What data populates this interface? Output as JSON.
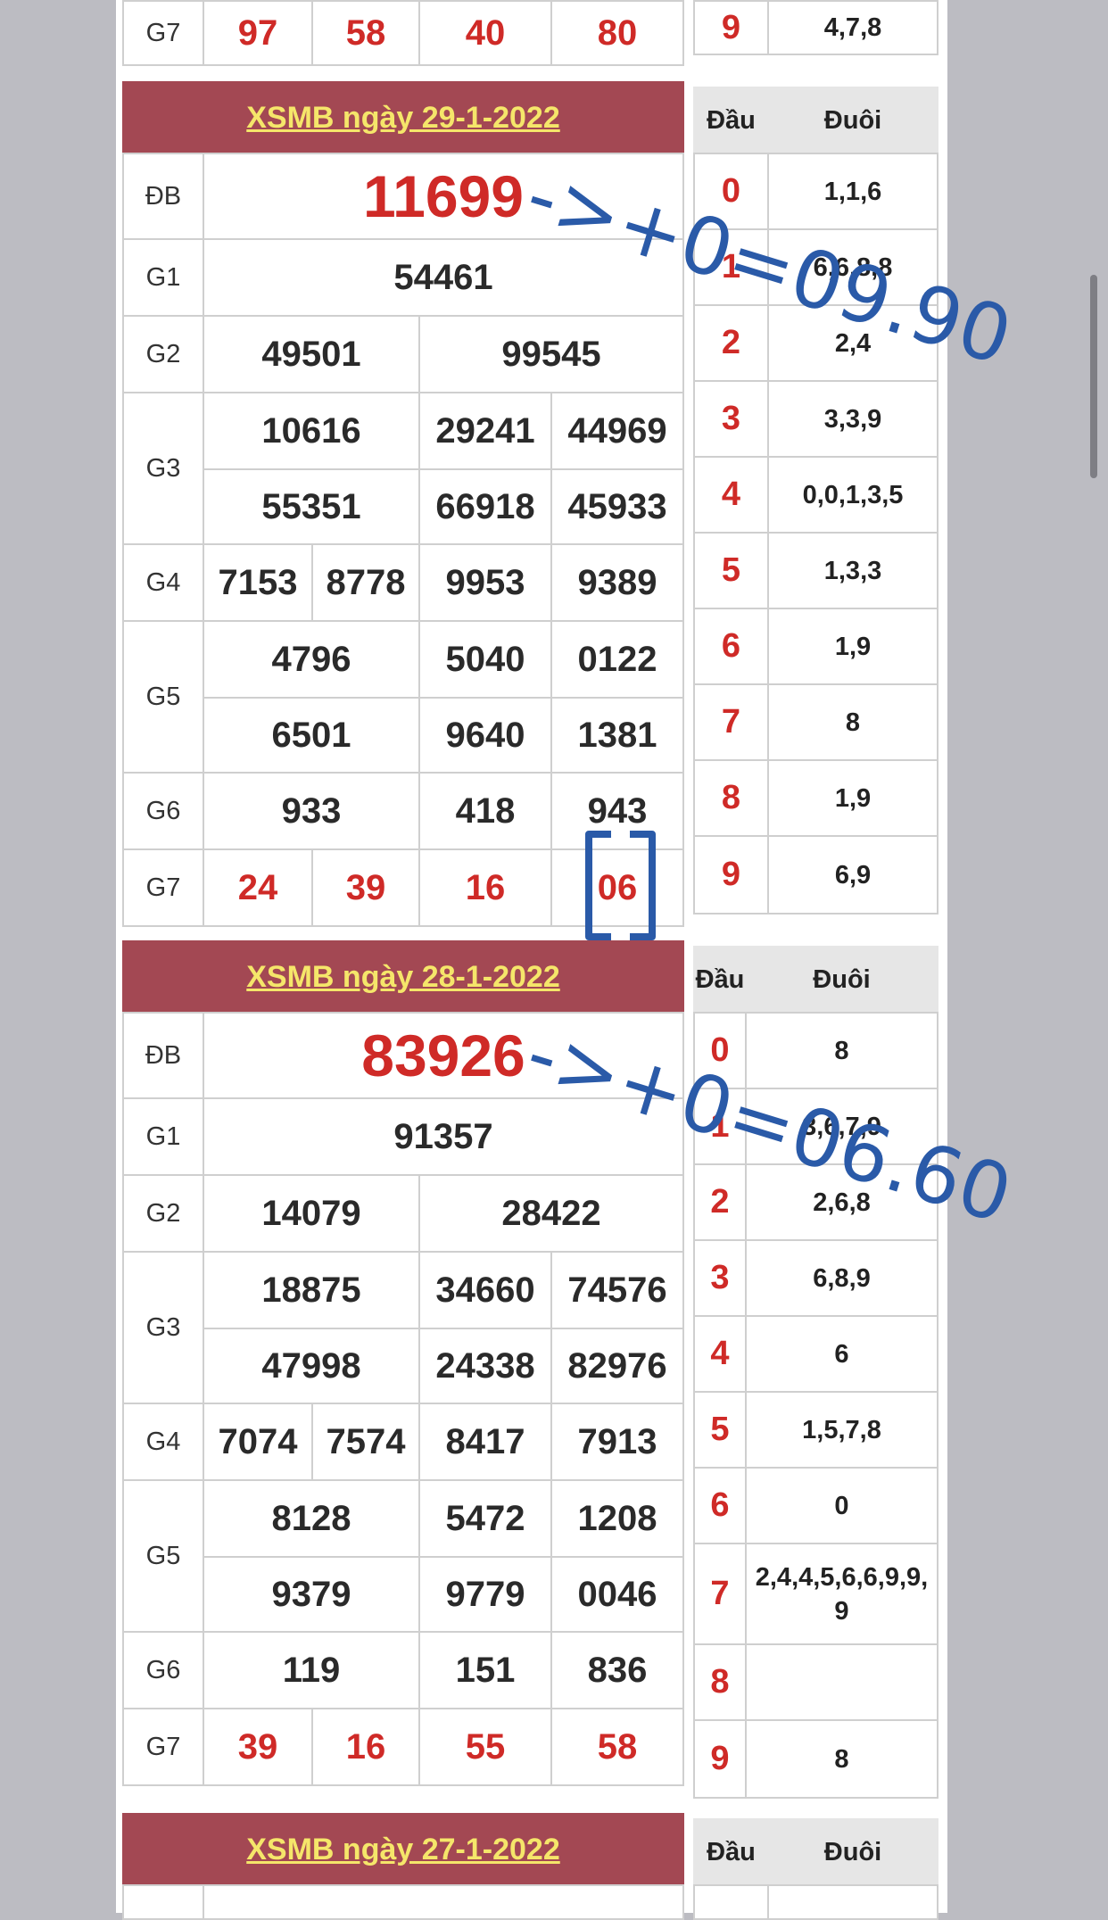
{
  "top_partial": {
    "prize_label": "G7",
    "g7": [
      "97",
      "58",
      "40",
      "80"
    ],
    "dau": "9",
    "duoi": "4,7,8"
  },
  "draw1": {
    "title": "XSMB ngày 29-1-2022",
    "labels": [
      "ĐB",
      "G1",
      "G2",
      "G3",
      "G4",
      "G5",
      "G6",
      "G7"
    ],
    "db": "11699",
    "g1": "54461",
    "g2": [
      "49501",
      "99545"
    ],
    "g3": [
      "10616",
      "29241",
      "44969",
      "55351",
      "66918",
      "45933"
    ],
    "g4": [
      "7153",
      "8778",
      "9953",
      "9389"
    ],
    "g5": [
      "4796",
      "5040",
      "0122",
      "6501",
      "9640",
      "1381"
    ],
    "g6": [
      "933",
      "418",
      "943"
    ],
    "g7": [
      "24",
      "39",
      "16",
      "06"
    ],
    "table_head": {
      "dau": "Đầu",
      "duoi": "Đuôi"
    },
    "table": [
      {
        "dau": "0",
        "duoi": "1,1,6"
      },
      {
        "dau": "1",
        "duoi": "6,6,8,8"
      },
      {
        "dau": "2",
        "duoi": "2,4"
      },
      {
        "dau": "3",
        "duoi": "3,3,9"
      },
      {
        "dau": "4",
        "duoi": "0,0,1,3,5"
      },
      {
        "dau": "5",
        "duoi": "1,3,3"
      },
      {
        "dau": "6",
        "duoi": "1,9"
      },
      {
        "dau": "7",
        "duoi": "8"
      },
      {
        "dau": "8",
        "duoi": "1,9"
      },
      {
        "dau": "9",
        "duoi": "6,9"
      }
    ],
    "annotation": "->+0=09.90"
  },
  "draw2": {
    "title": "XSMB ngày 28-1-2022",
    "labels": [
      "ĐB",
      "G1",
      "G2",
      "G3",
      "G4",
      "G5",
      "G6",
      "G7"
    ],
    "db": "83926",
    "g1": "91357",
    "g2": [
      "14079",
      "28422"
    ],
    "g3": [
      "18875",
      "34660",
      "74576",
      "47998",
      "24338",
      "82976"
    ],
    "g4": [
      "7074",
      "7574",
      "8417",
      "7913"
    ],
    "g5": [
      "8128",
      "5472",
      "1208",
      "9379",
      "9779",
      "0046"
    ],
    "g6": [
      "119",
      "151",
      "836"
    ],
    "g7": [
      "39",
      "16",
      "55",
      "58"
    ],
    "table_head": {
      "dau": "Đầu",
      "duoi": "Đuôi"
    },
    "table": [
      {
        "dau": "0",
        "duoi": "8"
      },
      {
        "dau": "1",
        "duoi": "3,6,7,9"
      },
      {
        "dau": "2",
        "duoi": "2,6,8"
      },
      {
        "dau": "3",
        "duoi": "6,8,9"
      },
      {
        "dau": "4",
        "duoi": "6"
      },
      {
        "dau": "5",
        "duoi": "1,5,7,8"
      },
      {
        "dau": "6",
        "duoi": "0"
      },
      {
        "dau": "7",
        "duoi": "2,4,4,5,6,6,9,9,9"
      },
      {
        "dau": "8",
        "duoi": ""
      },
      {
        "dau": "9",
        "duoi": "8"
      }
    ],
    "annotation": "->+0=06.60"
  },
  "draw3": {
    "title": "XSMB ngày 27-1-2022",
    "table_head": {
      "dau": "Đầu",
      "duoi": "Đuôi"
    }
  },
  "colors": {
    "header_bg": "#a34853",
    "header_text": "#f5e66a",
    "red": "#cf2a27",
    "annotation": "#2a5aa8"
  }
}
